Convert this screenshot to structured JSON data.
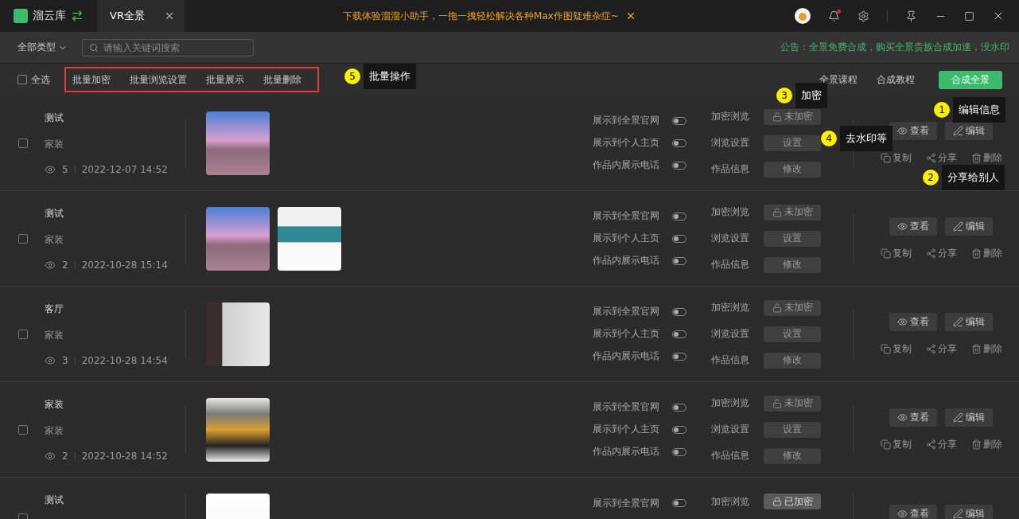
{
  "app": {
    "name": "溜云库",
    "tab": "VR全景",
    "promo": "下载体验溜溜小助手，一拖一拽轻松解决各种Max作图疑难杂症~"
  },
  "toolbar": {
    "filter": "全部类型",
    "search_placeholder": "请输入关键词搜索",
    "notice": "公告：全景免费合成，购买全景贵族合成加速，没水印"
  },
  "batch": {
    "select_all": {
      "label": "全选",
      "checked": false
    },
    "actions": [
      "批量加密",
      "批量浏览设置",
      "批量展示",
      "批量删除"
    ],
    "links": [
      "全景课程",
      "合成教程"
    ],
    "primary": "合成全景"
  },
  "rows": [
    {
      "title": "测试",
      "category": "家装",
      "views": "5",
      "date": "2022-12-07 14:52",
      "checked": false,
      "thumbnails": [
        {
          "kind": "outdoor"
        }
      ],
      "toggles": [
        {
          "label": "展示到全景官网",
          "on": false
        },
        {
          "label": "展示到个人主页",
          "on": false
        },
        {
          "label": "作品内展示电话",
          "on": false
        }
      ],
      "settings": [
        {
          "label": "加密浏览",
          "button": "未加密",
          "kind": "lock",
          "locked": false
        },
        {
          "label": "浏览设置",
          "button": "设置",
          "kind": "plain"
        },
        {
          "label": "作品信息",
          "button": "修改",
          "kind": "plain"
        }
      ],
      "buttons": [
        {
          "label": "查看",
          "kind": "view"
        },
        {
          "label": "编辑",
          "kind": "edit"
        }
      ],
      "links": [
        {
          "label": "复制",
          "kind": "copy"
        },
        {
          "label": "分享",
          "kind": "share"
        },
        {
          "label": "删除",
          "kind": "delete"
        }
      ]
    },
    {
      "title": "测试",
      "category": "家装",
      "views": "2",
      "date": "2022-10-28 15:14",
      "checked": false,
      "thumbnails": [
        {
          "kind": "outdoor"
        },
        {
          "kind": "bedroom"
        }
      ],
      "toggles": [
        {
          "label": "展示到全景官网",
          "on": false
        },
        {
          "label": "展示到个人主页",
          "on": false
        },
        {
          "label": "作品内展示电话",
          "on": false
        }
      ],
      "settings": [
        {
          "label": "加密浏览",
          "button": "未加密",
          "kind": "lock",
          "locked": false
        },
        {
          "label": "浏览设置",
          "button": "设置",
          "kind": "plain"
        },
        {
          "label": "作品信息",
          "button": "修改",
          "kind": "plain"
        }
      ],
      "buttons": [
        {
          "label": "查看",
          "kind": "view"
        },
        {
          "label": "编辑",
          "kind": "edit"
        }
      ],
      "links": [
        {
          "label": "复制",
          "kind": "copy"
        },
        {
          "label": "分享",
          "kind": "share"
        },
        {
          "label": "删除",
          "kind": "delete"
        }
      ]
    },
    {
      "title": "客厅",
      "category": "家装",
      "views": "3",
      "date": "2022-10-28 14:54",
      "checked": false,
      "thumbnails": [
        {
          "kind": "stairs"
        }
      ],
      "toggles": [
        {
          "label": "展示到全景官网",
          "on": false
        },
        {
          "label": "展示到个人主页",
          "on": false
        },
        {
          "label": "作品内展示电话",
          "on": false
        }
      ],
      "settings": [
        {
          "label": "加密浏览",
          "button": "未加密",
          "kind": "lock",
          "locked": false
        },
        {
          "label": "浏览设置",
          "button": "设置",
          "kind": "plain"
        },
        {
          "label": "作品信息",
          "button": "修改",
          "kind": "plain"
        }
      ],
      "buttons": [
        {
          "label": "查看",
          "kind": "view"
        },
        {
          "label": "编辑",
          "kind": "edit"
        }
      ],
      "links": [
        {
          "label": "复制",
          "kind": "copy"
        },
        {
          "label": "分享",
          "kind": "share"
        },
        {
          "label": "删除",
          "kind": "delete"
        }
      ]
    },
    {
      "title": "家装",
      "category": "家装",
      "views": "2",
      "date": "2022-10-28 14:52",
      "checked": false,
      "thumbnails": [
        {
          "kind": "living-room"
        }
      ],
      "toggles": [
        {
          "label": "展示到全景官网",
          "on": false
        },
        {
          "label": "展示到个人主页",
          "on": false
        },
        {
          "label": "作品内展示电话",
          "on": false
        }
      ],
      "settings": [
        {
          "label": "加密浏览",
          "button": "未加密",
          "kind": "lock",
          "locked": false
        },
        {
          "label": "浏览设置",
          "button": "设置",
          "kind": "plain"
        },
        {
          "label": "作品信息",
          "button": "修改",
          "kind": "plain"
        }
      ],
      "buttons": [
        {
          "label": "查看",
          "kind": "view"
        },
        {
          "label": "编辑",
          "kind": "edit"
        }
      ],
      "links": [
        {
          "label": "复制",
          "kind": "copy"
        },
        {
          "label": "分享",
          "kind": "share"
        },
        {
          "label": "删除",
          "kind": "delete"
        }
      ]
    },
    {
      "title": "测试",
      "checked": false,
      "thumbnails": [
        {
          "kind": "white-room"
        }
      ],
      "toggles": [
        {
          "label": "展示到全景官网",
          "on": false
        }
      ],
      "settings": [
        {
          "label": "加密浏览",
          "button": "已加密",
          "kind": "lock",
          "locked": true
        }
      ],
      "buttons": [
        {
          "label": "查看",
          "kind": "view"
        },
        {
          "label": "编辑",
          "kind": "edit"
        }
      ],
      "links": []
    }
  ],
  "callouts": [
    {
      "number": "1",
      "text": "编辑信息",
      "kind": "edit"
    },
    {
      "number": "2",
      "text": "分享给别人",
      "kind": "share"
    },
    {
      "number": "3",
      "text": "加密",
      "kind": "encrypt"
    },
    {
      "number": "4",
      "text": "去水印等",
      "kind": "settings"
    },
    {
      "number": "5",
      "text": "批量操作",
      "kind": "batch"
    }
  ]
}
